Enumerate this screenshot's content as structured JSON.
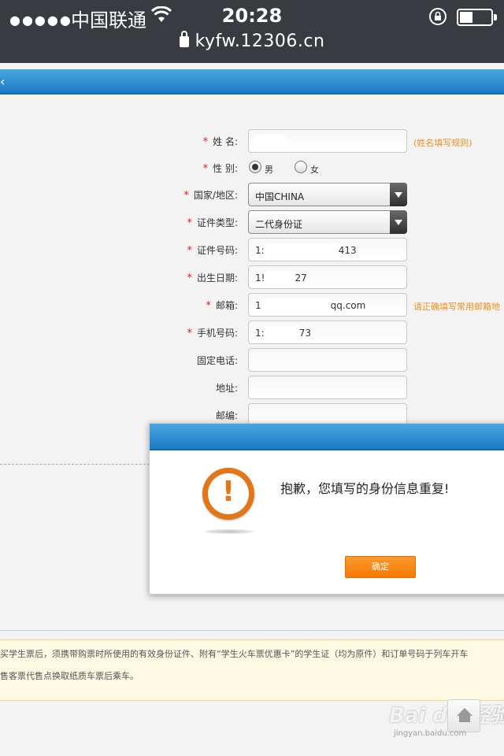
{
  "status_bar": {
    "signal": "●●●●●",
    "carrier": "中国联通",
    "time": "20:28",
    "url": "kyfw.12306.cn"
  },
  "form": {
    "name": {
      "label": "姓 名:",
      "hint": "(姓名填写规则)"
    },
    "gender": {
      "label": "性 别:",
      "male": "男",
      "female": "女"
    },
    "country": {
      "label": "国家/地区:",
      "value": "中国CHINA"
    },
    "id_type": {
      "label": "证件类型:",
      "value": "二代身份证"
    },
    "id_number": {
      "label": "证件号码:",
      "prefix": "1:",
      "suffix": "413"
    },
    "birth": {
      "label": "出生日期:",
      "prefix": "1!",
      "suffix": "27"
    },
    "email": {
      "label": "邮箱:",
      "prefix": "1",
      "suffix": "qq.com",
      "hint": "请正确填写常用邮箱地"
    },
    "mobile": {
      "label": "手机号码:",
      "prefix": "1:",
      "suffix": "73"
    },
    "landline": {
      "label": "固定电话:"
    },
    "address": {
      "label": "地址:"
    },
    "postcode": {
      "label": "邮编:"
    }
  },
  "notice": {
    "line1": "买学生票后，须携带购票时所使用的有效身份证件、附有“学生火车票优惠卡”的学生证（均为原件）和订单号码于列车开车",
    "line2": "售客票代售点换取纸质车票后乘车。"
  },
  "dialog": {
    "message": "抱歉，您填写的身份信息重复!",
    "confirm_label": "确定"
  },
  "watermark": {
    "brand": "Bai du 经验",
    "sub": "jingyan.baidu.com"
  }
}
